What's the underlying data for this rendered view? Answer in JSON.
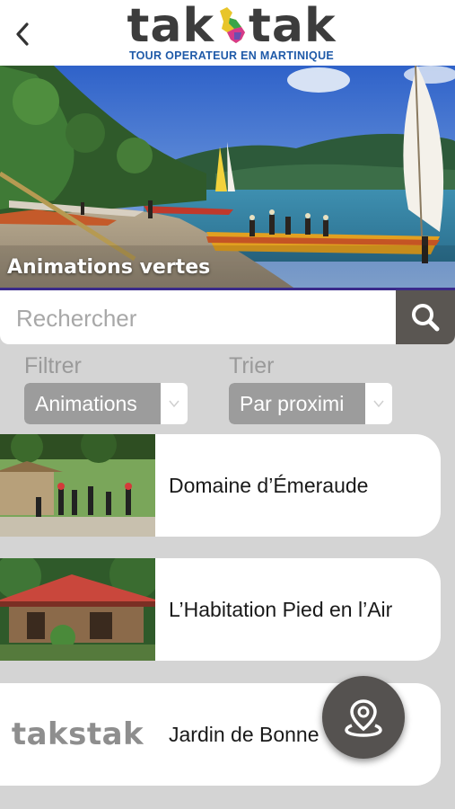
{
  "header": {
    "back_icon": "chevron-left-icon",
    "logo_word": "takstak",
    "logo_left": "tak",
    "logo_right": "tak",
    "logo_tagline": "TOUR OPERATEUR EN MARTINIQUE"
  },
  "hero": {
    "title": "Animations vertes"
  },
  "search": {
    "placeholder": "Rechercher",
    "icon": "search-icon"
  },
  "filter": {
    "label": "Filtrer",
    "value": "Animations"
  },
  "sort": {
    "label": "Trier",
    "value": "Par proximi"
  },
  "items": [
    {
      "name": "Domaine d’Émeraude"
    },
    {
      "name": "L’Habitation Pied en l’Air"
    },
    {
      "name": "Jardin de Bonne"
    }
  ],
  "fab": {
    "icon": "map-pin-icon"
  },
  "colors": {
    "accent_dark": "#5a5652",
    "logo_blue": "#1f5aa8",
    "background": "#d4d4d4"
  }
}
